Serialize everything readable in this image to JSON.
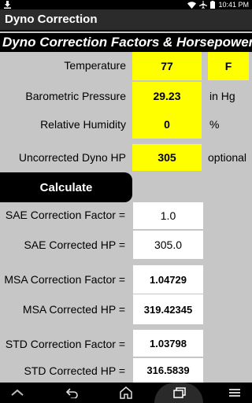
{
  "status": {
    "time": "10:41 PM"
  },
  "app": {
    "title": "Dyno Correction"
  },
  "banner": {
    "text": "Dyno Correction Factors & Horsepower"
  },
  "inputs": {
    "temperature": {
      "label": "Temperature",
      "value": "77",
      "unit": "F"
    },
    "pressure": {
      "label": "Barometric Pressure",
      "value": "29.23",
      "unit": "in Hg"
    },
    "humidity": {
      "label": "Relative Humidity",
      "value": "0",
      "unit": "%"
    },
    "dyno_hp": {
      "label": "Uncorrected Dyno HP",
      "value": "305",
      "unit": "optional"
    }
  },
  "calculate_label": "Calculate",
  "results": {
    "sae_factor": {
      "label": "SAE Correction Factor =",
      "value": "1.0"
    },
    "sae_hp": {
      "label": "SAE Corrected HP =",
      "value": "305.0"
    },
    "msa_factor": {
      "label": "MSA Correction Factor =",
      "value": "1.04729"
    },
    "msa_hp": {
      "label": "MSA Corrected HP =",
      "value": "319.42345"
    },
    "std_factor": {
      "label": "STD Correction Factor =",
      "value": "1.03798"
    },
    "std_hp": {
      "label": "STD Corrected HP =",
      "value": "316.5839"
    }
  },
  "icons": {
    "status": [
      "download-icon",
      "wifi-icon",
      "airplane-icon",
      "battery-icon"
    ],
    "nav": [
      "keyboard-hide-icon",
      "back-icon",
      "home-icon",
      "recents-icon",
      "menu-icon"
    ]
  }
}
